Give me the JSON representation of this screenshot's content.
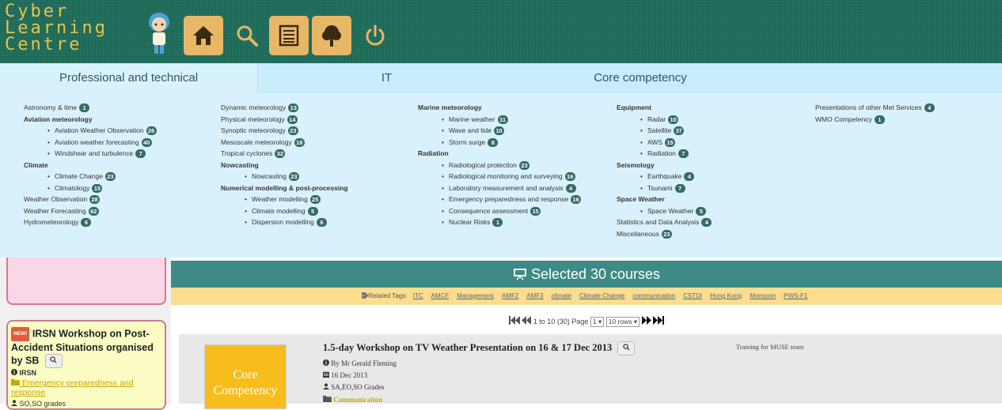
{
  "header": {
    "logo_lines": [
      "Cyber",
      "Learning",
      "Centre"
    ],
    "buttons": [
      "home-icon",
      "search-icon",
      "list-icon",
      "tree-icon",
      "power-icon"
    ]
  },
  "tabs": [
    {
      "label": "Professional and technical",
      "active": true
    },
    {
      "label": "IT",
      "active": false
    },
    {
      "label": "Core competency",
      "active": false
    }
  ],
  "categories": {
    "col1": [
      {
        "label": "Astronomy & time",
        "count": "1",
        "level": "top"
      },
      {
        "label": "Aviation meteorology",
        "count": "",
        "level": "head"
      },
      {
        "label": "Aviation Weather Observation",
        "count": "26",
        "level": "sub"
      },
      {
        "label": "Aviation weather forecasting",
        "count": "40",
        "level": "sub"
      },
      {
        "label": "Windshear and turbulence",
        "count": "7",
        "level": "sub"
      },
      {
        "label": "Climate",
        "count": "",
        "level": "head"
      },
      {
        "label": "Climate Change",
        "count": "23",
        "level": "sub"
      },
      {
        "label": "Climatology",
        "count": "15",
        "level": "sub"
      },
      {
        "label": "Weather Observation",
        "count": "28",
        "level": "top"
      },
      {
        "label": "Weather Forecasting",
        "count": "62",
        "level": "top"
      },
      {
        "label": "Hydrometeorology",
        "count": "6",
        "level": "top"
      }
    ],
    "col2": [
      {
        "label": "Dynamic meteorology",
        "count": "13",
        "level": "top"
      },
      {
        "label": "Physical meteorology",
        "count": "14",
        "level": "top"
      },
      {
        "label": "Synoptic meteorology",
        "count": "23",
        "level": "top"
      },
      {
        "label": "Mesoscale meteorology",
        "count": "18",
        "level": "top"
      },
      {
        "label": "Tropical cyclones",
        "count": "32",
        "level": "top"
      },
      {
        "label": "Nowcasting",
        "count": "",
        "level": "head"
      },
      {
        "label": "Nowcasting",
        "count": "23",
        "level": "sub"
      },
      {
        "label": "Numerical modelling & post-processing",
        "count": "",
        "level": "head"
      },
      {
        "label": "Weather modelling",
        "count": "25",
        "level": "sub"
      },
      {
        "label": "Climate modelling",
        "count": "5",
        "level": "sub"
      },
      {
        "label": "Dispersion modelling",
        "count": "6",
        "level": "sub"
      }
    ],
    "col3": [
      {
        "label": "Marine meteorology",
        "count": "",
        "level": "head"
      },
      {
        "label": "Marine weather",
        "count": "11",
        "level": "sub"
      },
      {
        "label": "Wave and tide",
        "count": "10",
        "level": "sub"
      },
      {
        "label": "Storm surge",
        "count": "8",
        "level": "sub"
      },
      {
        "label": "Radiation",
        "count": "",
        "level": "head"
      },
      {
        "label": "Radiological protection",
        "count": "23",
        "level": "sub"
      },
      {
        "label": "Radiological monitoring and surveying",
        "count": "16",
        "level": "sub"
      },
      {
        "label": "Laboratory measurement and analysis",
        "count": "4",
        "level": "sub"
      },
      {
        "label": "Emergency preparedness and response",
        "count": "16",
        "level": "sub"
      },
      {
        "label": "Consequence assessment",
        "count": "15",
        "level": "sub"
      },
      {
        "label": "Nuclear Risks",
        "count": "1",
        "level": "sub"
      }
    ],
    "col4": [
      {
        "label": "Equipment",
        "count": "",
        "level": "head"
      },
      {
        "label": "Radar",
        "count": "10",
        "level": "sub"
      },
      {
        "label": "Satellite",
        "count": "37",
        "level": "sub"
      },
      {
        "label": "AWS",
        "count": "15",
        "level": "sub"
      },
      {
        "label": "Radiation",
        "count": "7",
        "level": "sub"
      },
      {
        "label": "Seismology",
        "count": "",
        "level": "head"
      },
      {
        "label": "Earthquake",
        "count": "4",
        "level": "sub"
      },
      {
        "label": "Tsunami",
        "count": "7",
        "level": "sub"
      },
      {
        "label": "Space Weather",
        "count": "",
        "level": "head"
      },
      {
        "label": "Space Weather",
        "count": "5",
        "level": "sub"
      },
      {
        "label": "Statistics and Data Analysis",
        "count": "4",
        "level": "top"
      },
      {
        "label": "Miscellaneous",
        "count": "23",
        "level": "top"
      }
    ],
    "col5": [
      {
        "label": "Presentations of other Met Services",
        "count": "4",
        "level": "top"
      },
      {
        "label": "WMO Competency",
        "count": "1",
        "level": "top"
      }
    ]
  },
  "sidebar": {
    "news": {
      "tag": "NEW!",
      "title": "IRSN Workshop on Post-Accident Situations organised by SB",
      "org": "IRSN",
      "category": "Emergency preparedness and response",
      "grade": "SO,SO grades"
    }
  },
  "banner": {
    "title": "Selected 30 courses"
  },
  "related_tags": {
    "label": "Related Tags:",
    "tags": [
      "ITC",
      "AMCF",
      "Management",
      "AMF2",
      "AMF3",
      "climate",
      "Climate Change",
      "communication",
      "CSTDI",
      "Hong Kong",
      "Monsoon",
      "PWS-F1"
    ]
  },
  "pager": {
    "range": "1 to 10 (30)",
    "page_label": "Page",
    "page_value": "1",
    "rows_value": "10 rows"
  },
  "course": {
    "badge_line1": "Core",
    "badge_line2": "Competency",
    "title": "1.5-day Workshop on TV Weather Presentation on 16 & 17 Dec 2013",
    "by": "By Mr Gerald Fleming",
    "date": "16 Dec 2013",
    "grades": "SA,EO,SO Grades",
    "category": "Communication",
    "note": "Training for MUSE team"
  },
  "colors": {
    "header_bg": "#1f6b5a",
    "logo": "#e8c34a",
    "button_bg": "#e7b766",
    "tab_bg": "#c9ecfa",
    "panel_bg": "#d9f1fc",
    "badge": "#356b63",
    "banner": "#3d8a86",
    "tagsbar": "#fcdc8e",
    "core_badge": "#f6bd1c"
  }
}
